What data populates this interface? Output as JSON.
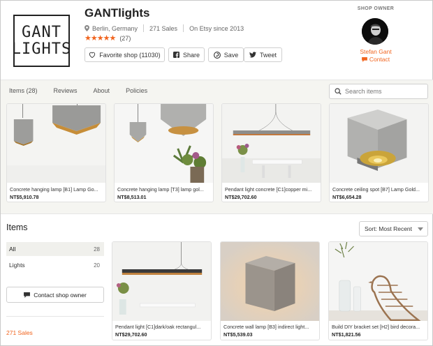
{
  "shop": {
    "logo_line1": "GANT",
    "logo_line2": "LIGHTS",
    "name": "GANTlights",
    "location": "Berlin, Germany",
    "sales": "271 Sales",
    "since": "On Etsy since 2013",
    "stars": "★★★★★",
    "review_count": "(27)"
  },
  "actions": {
    "favorite": "Favorite shop (11030)",
    "share": "Share",
    "save": "Save",
    "tweet": "Tweet"
  },
  "owner": {
    "label": "SHOP OWNER",
    "name": "Stefan Gant",
    "contact": "Contact"
  },
  "tabs": [
    "Items (28)",
    "Reviews",
    "About",
    "Policies"
  ],
  "search": {
    "placeholder": "Search items"
  },
  "featured": [
    {
      "title": "Concrete hanging lamp [B1] Lamp Go...",
      "price": "NT$5,910.78"
    },
    {
      "title": "Concrete hanging lamp [T3] lamp gol...",
      "price": "NT$8,513.01"
    },
    {
      "title": "Pendant light concrete [C1]copper mi...",
      "price": "NT$29,702.60"
    },
    {
      "title": "Concrete ceiling spot [B7] Lamp Gold...",
      "price": "NT$6,654.28"
    }
  ],
  "items_section": {
    "heading": "Items",
    "sort": "Sort: Most Recent",
    "sections": [
      {
        "label": "All",
        "count": "28"
      },
      {
        "label": "Lights",
        "count": "20"
      }
    ],
    "contact_button": "Contact shop owner",
    "sales_link": "271 Sales"
  },
  "listings": [
    {
      "title": "Pendant light [C1]dark/oak rectangul...",
      "price": "NT$29,702.60"
    },
    {
      "title": "Concrete wall lamp [B3] indirect light...",
      "price": "NT$5,539.03"
    },
    {
      "title": "Build DIY bracket set [H2] bird decora...",
      "price": "NT$1,821.56"
    }
  ],
  "colors": {
    "accent": "#f1641e",
    "band": "#f5f5f1"
  }
}
